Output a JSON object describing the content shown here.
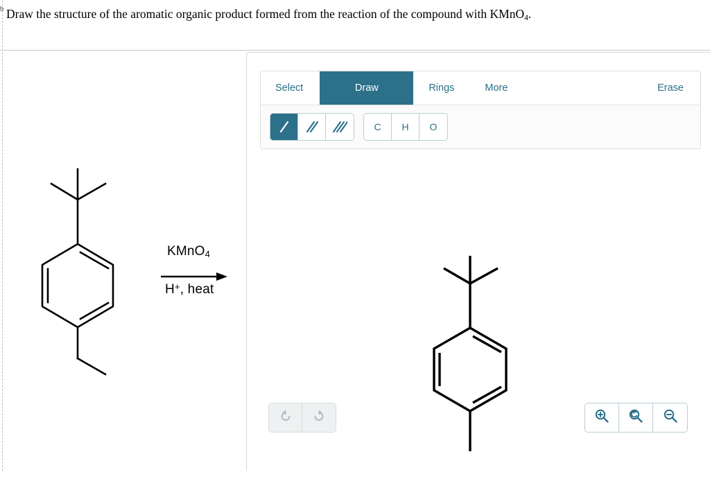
{
  "prompt": {
    "leading_clipped_glyph": "b",
    "text_before_sub": "Draw the structure of the aromatic organic product formed from the reaction of the compound with KMnO",
    "subscript": "4",
    "text_after_sub": "."
  },
  "reaction": {
    "reagent_above_arrow": "KMnO",
    "reagent_above_sub": "4",
    "reagent_below_arrow_h": "H",
    "reagent_below_sup": "+",
    "reagent_below_rest": ", heat",
    "reactant_name": "4-tert-butylethylbenzene",
    "arrow": "reaction-arrow"
  },
  "toolbar": {
    "tabs": [
      {
        "label": "Select",
        "active": false,
        "name": "tab-select"
      },
      {
        "label": "Draw",
        "active": true,
        "name": "tab-draw"
      },
      {
        "label": "Rings",
        "active": false,
        "name": "tab-rings"
      },
      {
        "label": "More",
        "active": false,
        "name": "tab-more"
      }
    ],
    "erase_label": "Erase",
    "bond_tools": [
      {
        "icon": "single-bond-icon",
        "active": true
      },
      {
        "icon": "double-bond-icon",
        "active": false
      },
      {
        "icon": "triple-bond-icon",
        "active": false
      }
    ],
    "atom_tools": [
      {
        "label": "C",
        "name": "atom-button-carbon"
      },
      {
        "label": "H",
        "name": "atom-button-hydrogen"
      },
      {
        "label": "O",
        "name": "atom-button-oxygen"
      }
    ]
  },
  "controls": {
    "undo": {
      "icon": "undo-icon",
      "enabled": false
    },
    "redo": {
      "icon": "redo-icon",
      "enabled": false
    },
    "zoom_in": {
      "icon": "zoom-in-icon"
    },
    "zoom_reset": {
      "icon": "zoom-reset-icon"
    },
    "zoom_out": {
      "icon": "zoom-out-icon"
    }
  },
  "canvas": {
    "drawn_molecule": "benzene ring with tert-butyl group at top and methyl stub at bottom"
  },
  "colors": {
    "accent_teal": "#2c7289",
    "tool_border": "#b9ccd4",
    "panel_border": "#d5d5d5",
    "disabled_gray": "#a9bcc4",
    "bond_black": "#000000"
  }
}
